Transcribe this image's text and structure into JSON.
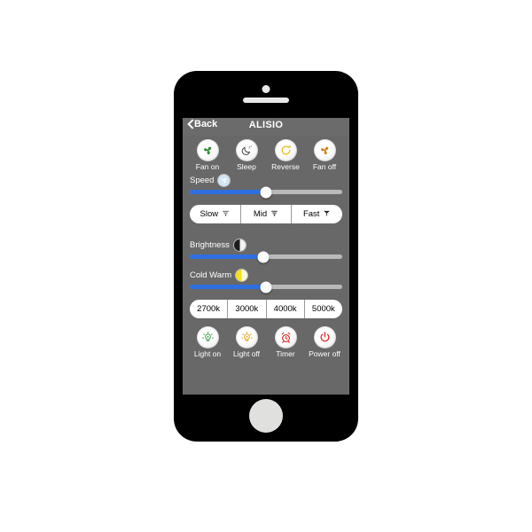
{
  "app": {
    "nav": {
      "back_label": "Back",
      "back_icon": "chevron-left-icon",
      "title": "ALISIO"
    },
    "fan_controls": [
      {
        "label": "Fan on",
        "icon": "fan-icon",
        "color": "#2f8a2f"
      },
      {
        "label": "Sleep",
        "icon": "moon-sleep-icon",
        "color": "#555555"
      },
      {
        "label": "Reverse",
        "icon": "reverse-arrow-icon",
        "color": "#e8c41c"
      },
      {
        "label": "Fan off",
        "icon": "fan-icon",
        "color": "#d4820f"
      }
    ],
    "speed": {
      "label": "Speed",
      "badge_icon": "fan-badge-icon",
      "badge_color": "#cfe4f5",
      "value_percent": 50,
      "fill_color": "#2f6fe0",
      "track_color": "#b9b9b9"
    },
    "speed_presets": [
      {
        "label": "Slow",
        "icon": "fan-speed-slow-icon"
      },
      {
        "label": "Mid",
        "icon": "fan-speed-mid-icon"
      },
      {
        "label": "Fast",
        "icon": "fan-speed-fast-icon"
      }
    ],
    "brightness": {
      "label": "Brightness",
      "badge_icon": "half-moon-contrast-icon",
      "value_percent": 48,
      "fill_color": "#2f6fe0",
      "track_color": "#b9b9b9"
    },
    "cold_warm": {
      "label": "Cold Warm",
      "badge_icon": "half-moon-warm-icon",
      "badge_color": "#f5e11c",
      "value_percent": 50,
      "fill_color": "#2f6fe0",
      "track_color": "#b9b9b9"
    },
    "color_temperatures": [
      {
        "label": "2700k"
      },
      {
        "label": "3000k"
      },
      {
        "label": "4000k"
      },
      {
        "label": "5000k"
      }
    ],
    "light_controls": [
      {
        "label": "Light on",
        "icon": "light-bulb-on-icon",
        "color": "#3f9e4d"
      },
      {
        "label": "Light off",
        "icon": "light-bulb-off-icon",
        "color": "#e0a81c"
      },
      {
        "label": "Timer",
        "icon": "alarm-clock-icon",
        "color": "#e02020"
      },
      {
        "label": "Power off",
        "icon": "power-icon",
        "color": "#e02020"
      }
    ]
  }
}
